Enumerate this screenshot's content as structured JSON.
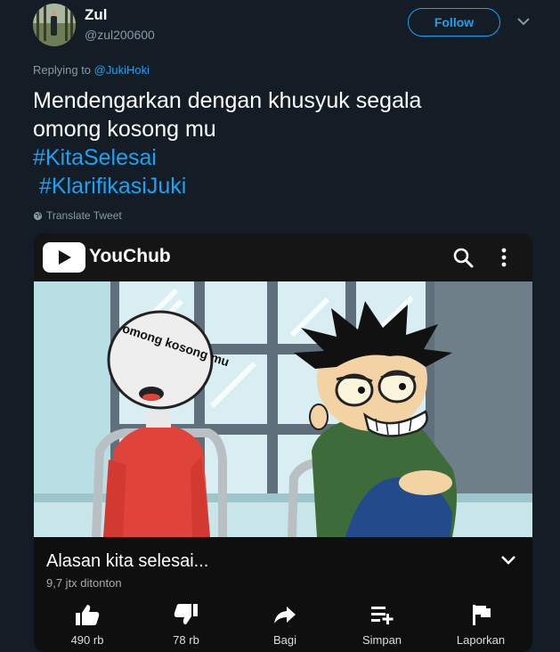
{
  "user": {
    "name": "Zul",
    "handle": "@zul200600"
  },
  "follow_label": "Follow",
  "reply": {
    "prefix": "Replying to ",
    "to": "@JukiHoki"
  },
  "tweet": {
    "line1": "Mendengarkan dengan khusyuk segala",
    "line2": "omong kosong mu",
    "hashtag1": "#KitaSelesai",
    "hashtag2": " #KlarifikasiJuki"
  },
  "translate_label": "Translate Tweet",
  "video": {
    "app_title": "YouChub",
    "balloon_text": "omong kosong mu",
    "title": "Alasan kita selesai...",
    "views": "9,7 jtx ditonton",
    "actions": [
      {
        "icon": "thumbs-up-icon",
        "label": "490 rb"
      },
      {
        "icon": "thumbs-down-icon",
        "label": "78 rb"
      },
      {
        "icon": "share-icon",
        "label": "Bagi"
      },
      {
        "icon": "playlist-add-icon",
        "label": "Simpan"
      },
      {
        "icon": "flag-icon",
        "label": "Laporkan"
      }
    ]
  },
  "colors": {
    "background": "#141d26",
    "accent": "#1da1f2",
    "muted": "#8899a6"
  }
}
